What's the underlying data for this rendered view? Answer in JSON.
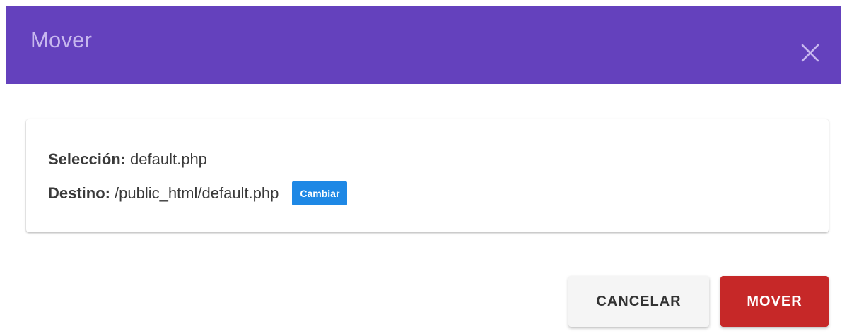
{
  "dialog": {
    "title": "Mover",
    "header_color": "#6441bd",
    "close_icon": "close-icon"
  },
  "details": {
    "selection_label": "Selección:",
    "selection_value": "default.php",
    "destination_label": "Destino:",
    "destination_value": "/public_html/default.php",
    "change_label": "Cambiar",
    "change_color": "#1e88e5"
  },
  "actions": {
    "cancel_label": "CANCELAR",
    "move_label": "MOVER",
    "move_color": "#c62828"
  }
}
